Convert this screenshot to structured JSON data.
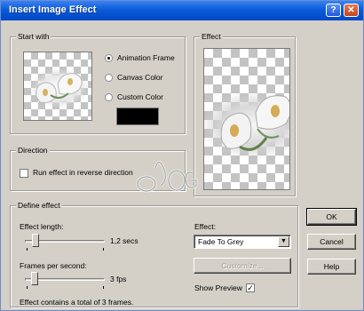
{
  "window": {
    "title": "Insert Image Effect",
    "help_glyph": "?",
    "close_glyph": "✕"
  },
  "start_with": {
    "legend": "Start with",
    "options": [
      {
        "label": "Animation Frame",
        "selected": true
      },
      {
        "label": "Canvas Color",
        "selected": false
      },
      {
        "label": "Custom Color",
        "selected": false
      }
    ],
    "custom_color": "#000000"
  },
  "effect_preview": {
    "legend": "Effect"
  },
  "direction": {
    "legend": "Direction",
    "reverse_label": "Run effect in reverse direction",
    "reverse_checked": false
  },
  "define_effect": {
    "legend": "Define effect",
    "length_label": "Effect length:",
    "length_value": "1,2 secs",
    "length_fraction": 0.1,
    "fps_label": "Frames per second:",
    "fps_value": "3 fps",
    "fps_fraction": 0.08,
    "summary": "Effect contains a total of 3 frames.",
    "effect_label": "Effect:",
    "effect_selected": "Fade To Grey",
    "customize_label": "Customize...",
    "show_preview_label": "Show Preview",
    "show_preview_checked": true,
    "check_glyph": "✓"
  },
  "buttons": {
    "ok": "OK",
    "cancel": "Cancel",
    "help": "Help"
  },
  "watermark": {
    "text": "AOG"
  },
  "colors": {
    "titlebar": "#0a5bd8",
    "dialog_bg": "#d4d0c8",
    "checker": "#c3c3c3"
  }
}
